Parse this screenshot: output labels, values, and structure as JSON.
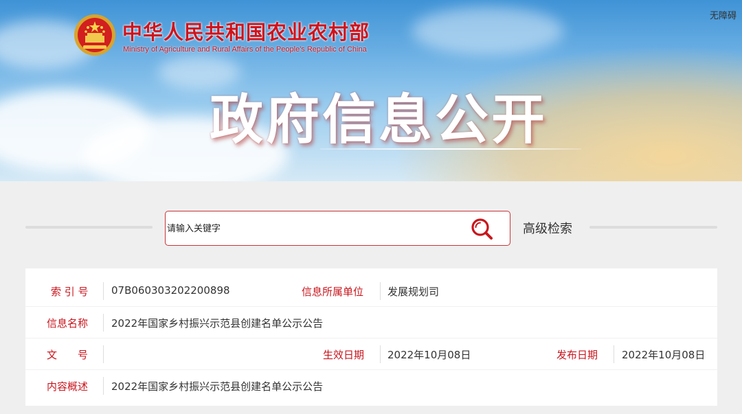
{
  "header": {
    "ministry_cn": "中华人民共和国农业农村部",
    "ministry_en": "Ministry of Agriculture and Rural Affairs of the People's Republic of China",
    "accessibility": "无障碍",
    "banner_title": "政府信息公开",
    "colors": {
      "brand_red": "#d0121b",
      "sky_blue": "#5aa7e0",
      "wheat": "#f3d196"
    }
  },
  "search": {
    "placeholder": "请输入关键字",
    "icon": "search-icon",
    "advanced_label": "高级检索"
  },
  "info": {
    "index_label": "索 引 号",
    "index_value": "07B060303202200898",
    "unit_label": "信息所属单位",
    "unit_value": "发展规划司",
    "name_label": "信息名称",
    "name_value": "2022年国家乡村振兴示范县创建名单公示公告",
    "doc_label": "文　　号",
    "doc_value": "",
    "effective_label": "生效日期",
    "effective_value": "2022年10月08日",
    "publish_label": "发布日期",
    "publish_value": "2022年10月08日",
    "summary_label": "内容概述",
    "summary_value": "2022年国家乡村振兴示范县创建名单公示公告"
  }
}
